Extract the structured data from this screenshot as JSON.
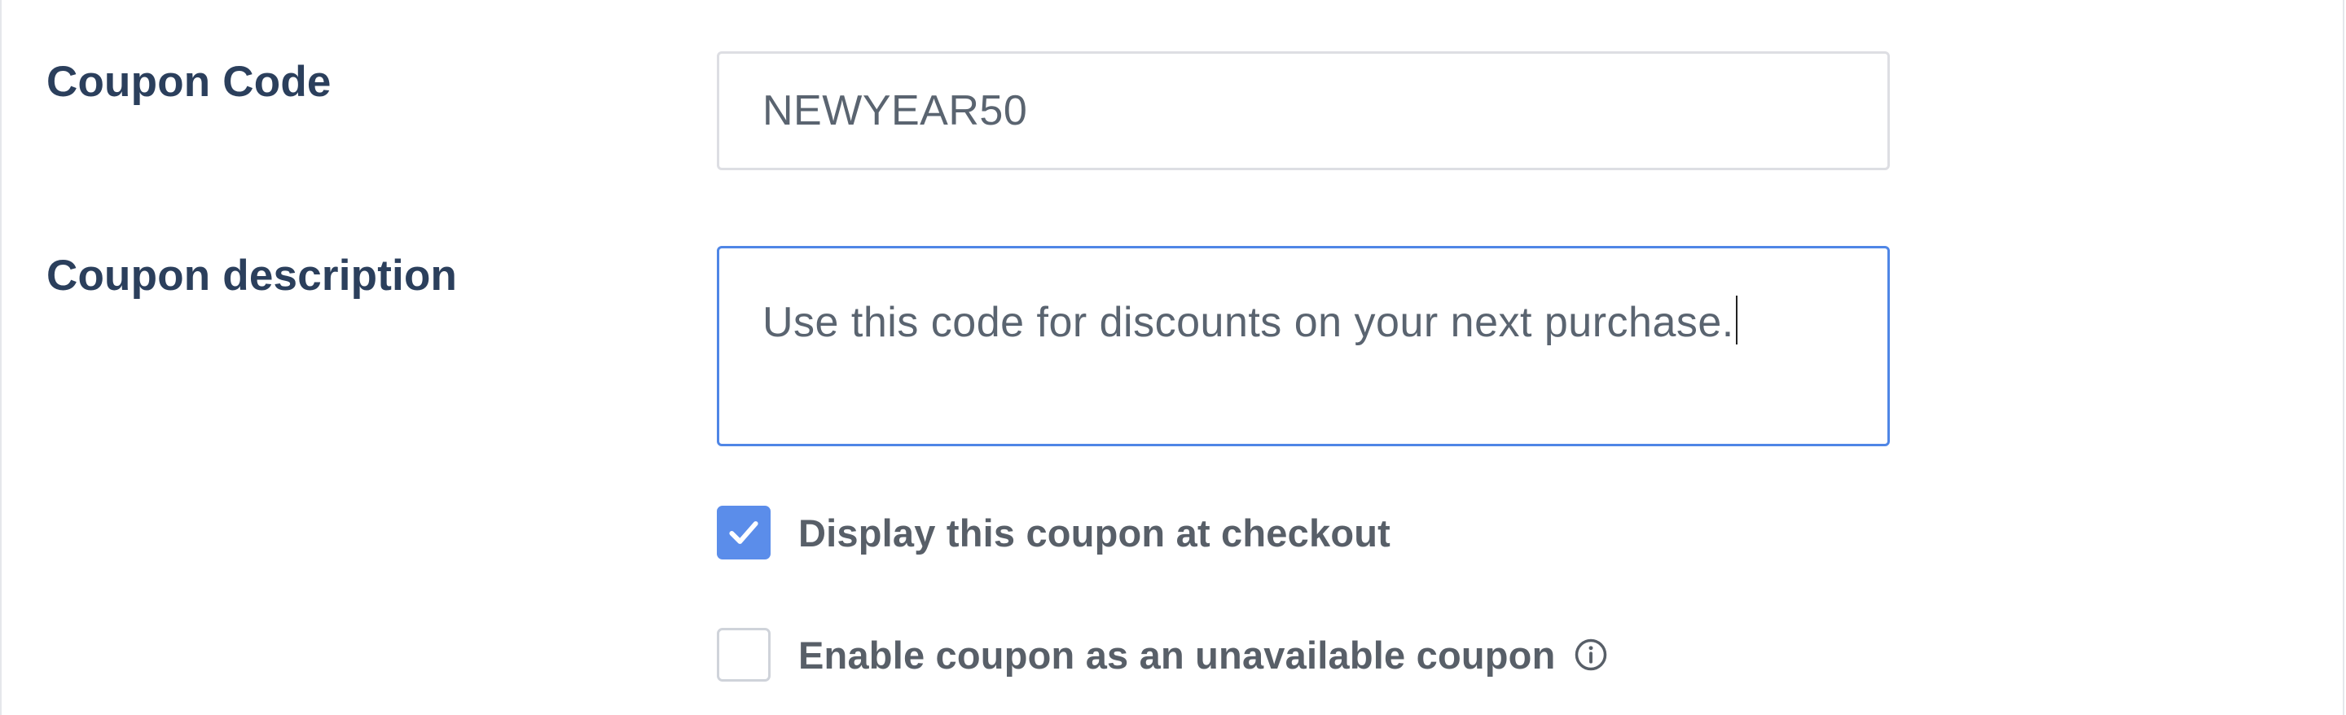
{
  "form": {
    "coupon_code": {
      "label": "Coupon Code",
      "value": "NEWYEAR50"
    },
    "coupon_description": {
      "label": "Coupon description",
      "value": "Use this code for discounts on your next purchase."
    },
    "display_at_checkout": {
      "label": "Display this coupon at checkout",
      "checked": true
    },
    "enable_unavailable": {
      "label": "Enable coupon as an unavailable coupon",
      "checked": false,
      "info_icon": "info-circle-icon"
    }
  },
  "colors": {
    "label_text": "#2b3f5c",
    "input_text": "#5a6470",
    "focus_border": "#4f86e6",
    "checkbox_checked": "#5b8dea",
    "checkbox_label": "#585f68"
  }
}
